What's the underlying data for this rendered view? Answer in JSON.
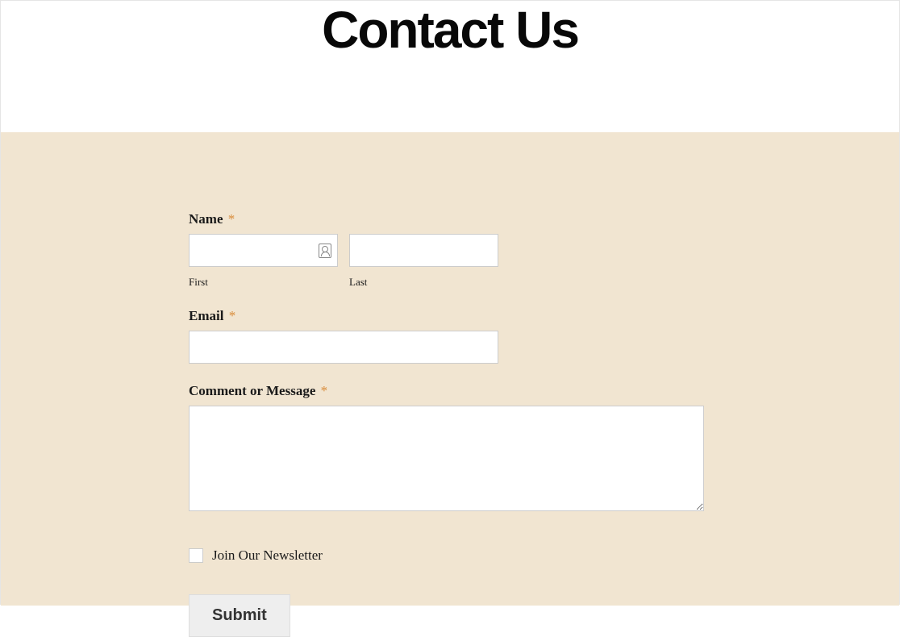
{
  "header": {
    "title": "Contact Us"
  },
  "form": {
    "name": {
      "label": "Name",
      "required": "*",
      "first": {
        "sublabel": "First",
        "value": ""
      },
      "last": {
        "sublabel": "Last",
        "value": ""
      }
    },
    "email": {
      "label": "Email",
      "required": "*",
      "value": ""
    },
    "comment": {
      "label": "Comment or Message",
      "required": "*",
      "value": ""
    },
    "newsletter": {
      "label": "Join Our Newsletter",
      "checked": false
    },
    "submit": {
      "label": "Submit"
    }
  }
}
